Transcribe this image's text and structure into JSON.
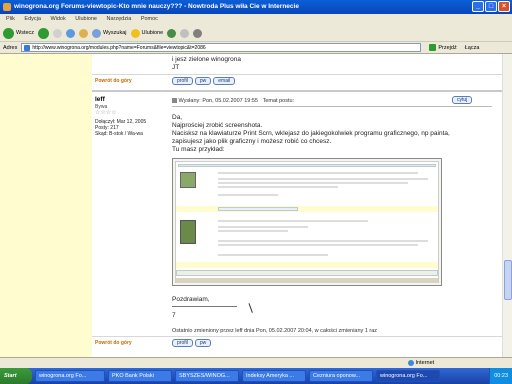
{
  "window": {
    "title": "winogrona.org Forums-viewtopic-Kto mnie nauczy??? - Nowtroda Plus wiła Cie w Internecie",
    "min": "_",
    "max": "□",
    "close": "×"
  },
  "menu": [
    "Plik",
    "Edycja",
    "Widok",
    "Ulubione",
    "Narzędzia",
    "Pomoc"
  ],
  "toolbar": {
    "back": "Wstecz",
    "search": "Wyszukaj",
    "favorites": "Ulubione"
  },
  "address": {
    "label": "Adres",
    "url": "http://www.winogrona.org/modules.php?name=Forums&file=viewtopic&t=2086",
    "go": "Przejdź",
    "links": "Łącza"
  },
  "post1": {
    "text1": "i jesz zielone winogrona",
    "text2": "JT",
    "top_link": "Powrót do góry",
    "btn_profile": "profil",
    "btn_pw": "pw",
    "btn_email": "email"
  },
  "post2": {
    "author": "leff",
    "rank": "Bywa",
    "stars": "☆☆☆☆",
    "joined": "Dołączył: Mar 12, 2005",
    "posts": "Posty: 217",
    "from": "Skąd: B-stok / Wa-wa",
    "header_sent": "Wysłany: Pon, 05.02.2007 19:55",
    "header_subject": "Temat postu:",
    "quote_btn": "cytuj",
    "lines": [
      "Da,",
      "Najprościej zrobić screenshota.",
      "Nacisksz na klawiaturze Print Scrn, wklejasz do jakiegokolwiek programu graficznego, np painta,",
      "zapisujesz jako plik graficzny i możesz robić co chcesz.",
      "Tu masz przykład:"
    ],
    "greet": "Pozdrawiam,",
    "signature": "7",
    "edited": "Ostatnio zmieniony przez leff dnia Pon, 05.02.2007 20:04, w całości zmieniany 1 raz",
    "top_link": "Powrót do góry",
    "btn_profile": "profil",
    "btn_pw": "pw"
  },
  "status": {
    "left": "",
    "zone": "Internet"
  },
  "taskbar": {
    "start": "Start",
    "tasks": [
      "winogrona.org Fo...",
      "PKO Bank Polski",
      "SBYSZES/WINOG...",
      "Indeksy Ameryka ...",
      "Cezniura oponow...",
      "winogrona.org Fo..."
    ],
    "clock": "00:23"
  },
  "colors": {
    "titlebar": "#0846b8",
    "leftcol": "#fffccf",
    "link": "#cc6600"
  }
}
